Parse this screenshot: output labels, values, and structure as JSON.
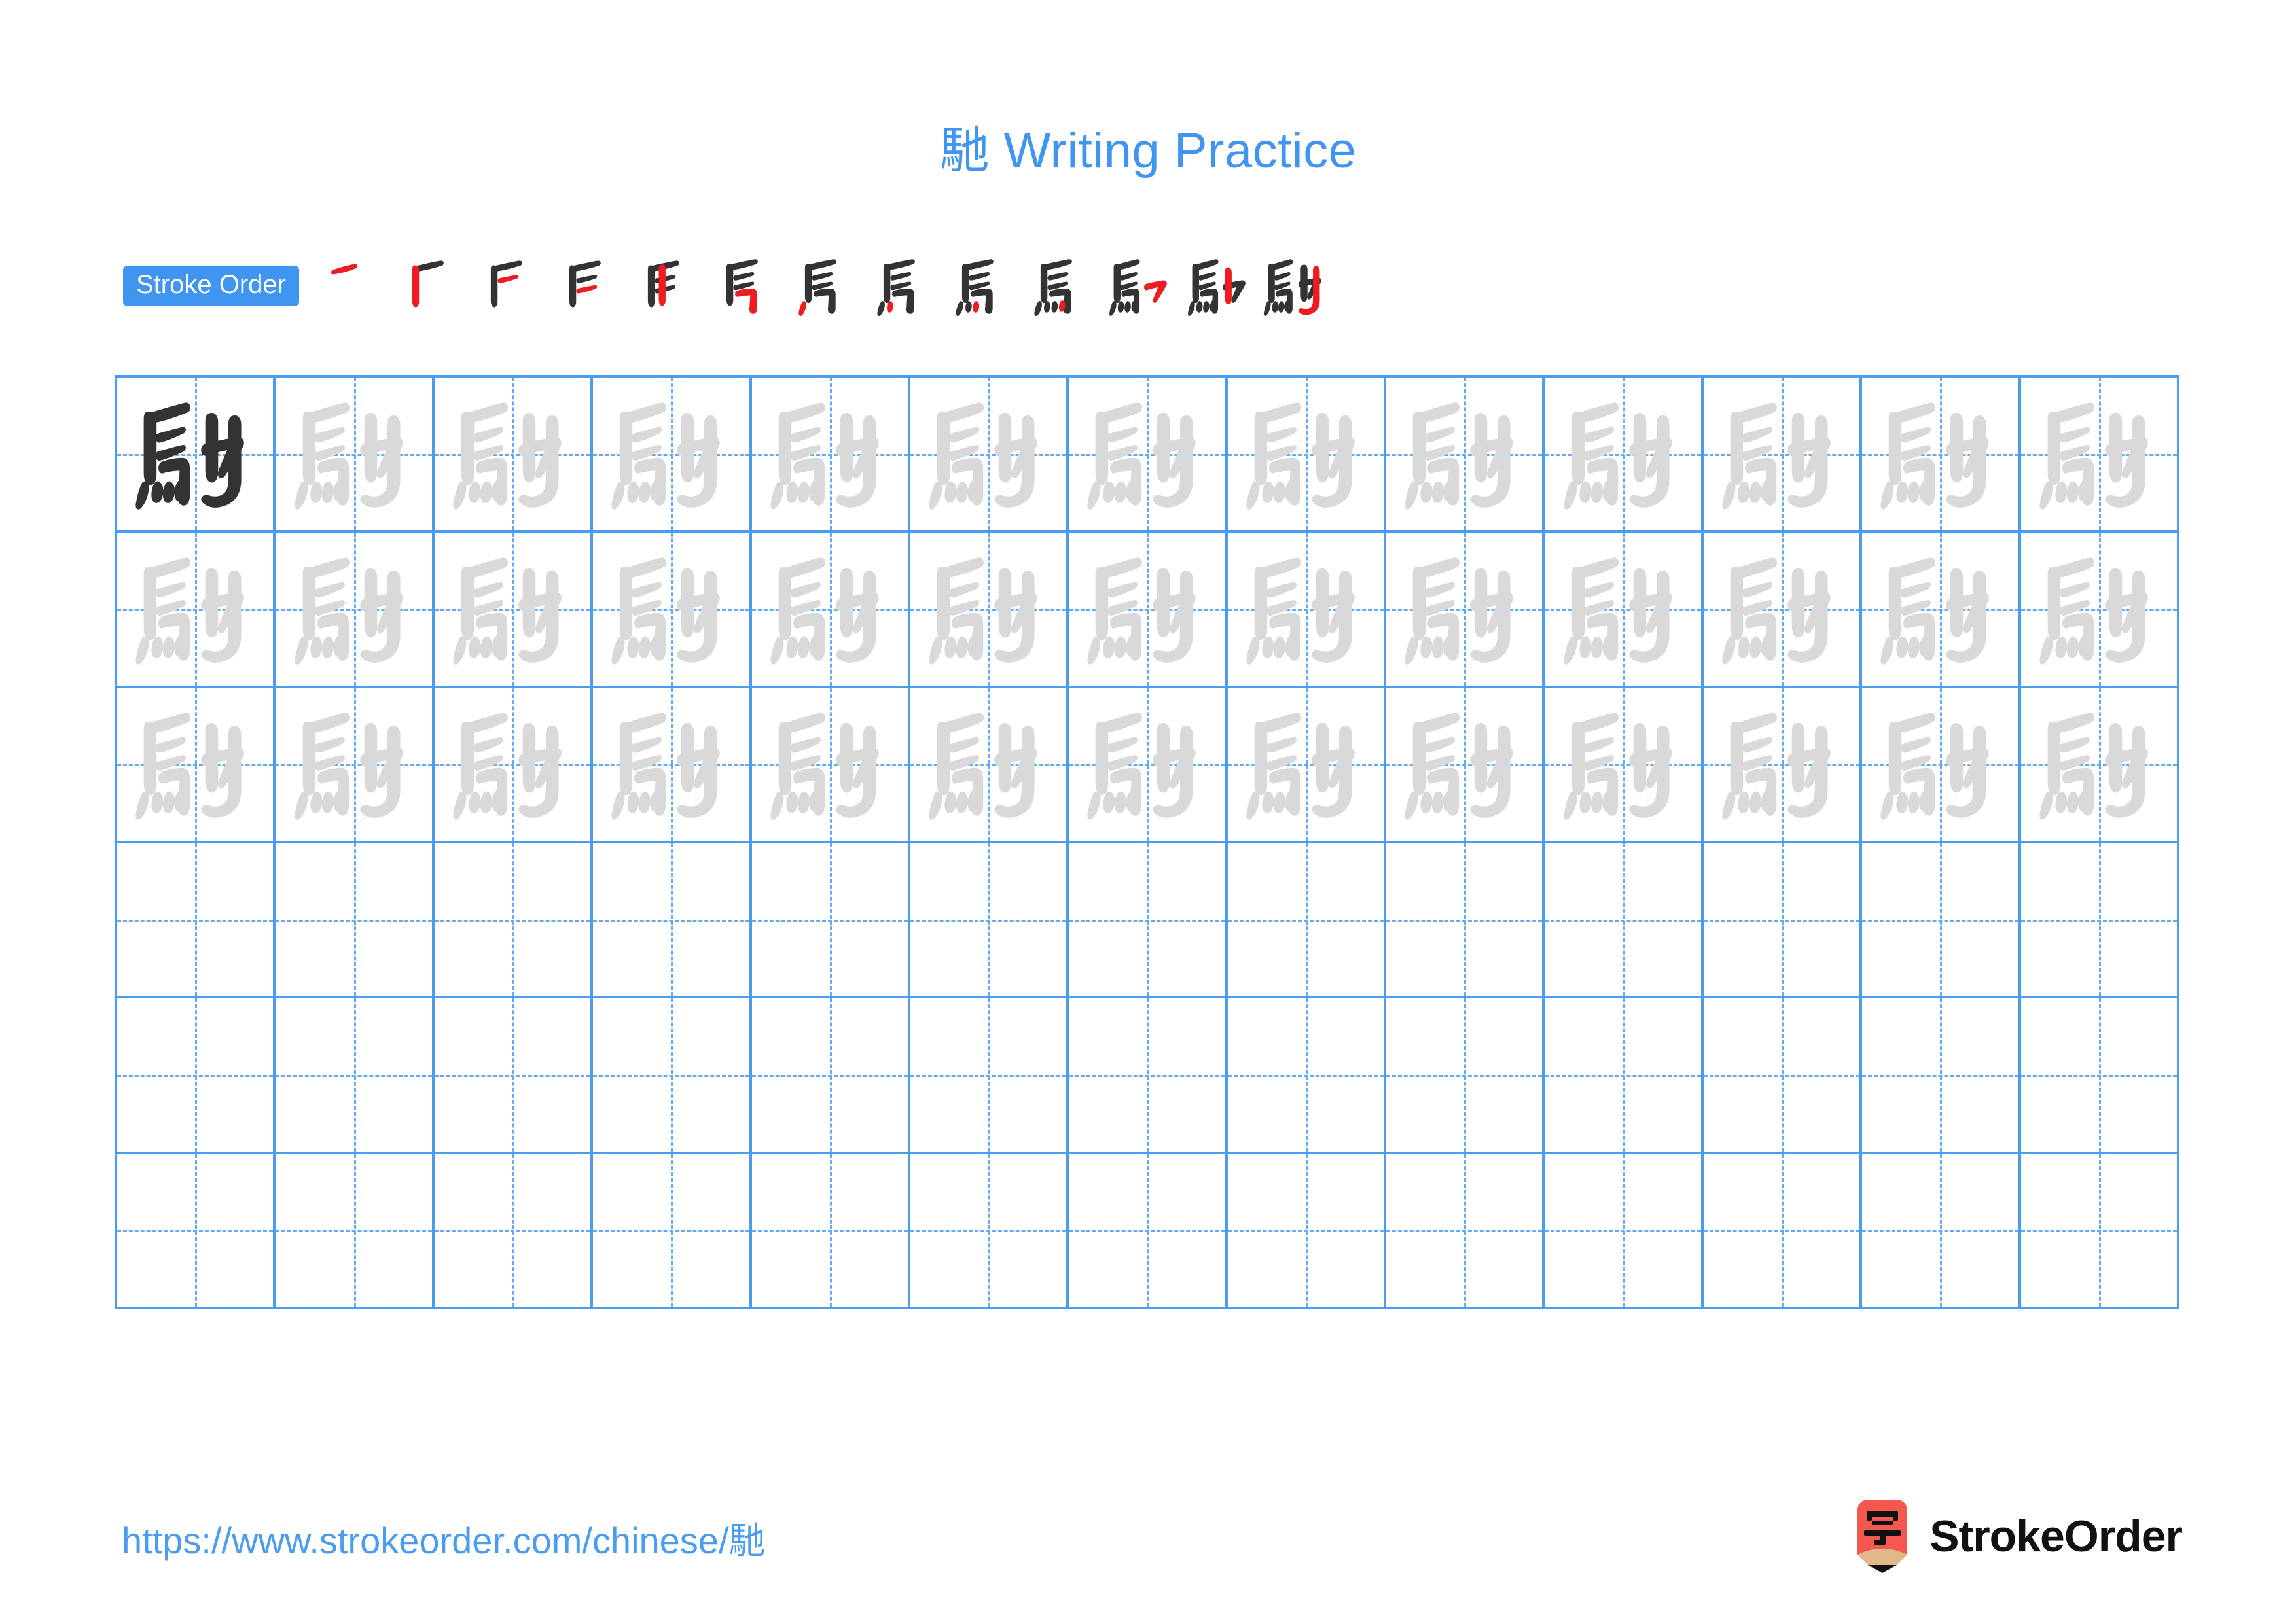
{
  "character": "馳",
  "title": "馳 Writing Practice",
  "stroke_order": {
    "badge_label": "Stroke Order",
    "total_strokes": 13,
    "steps": [
      {
        "index": 1,
        "new_stroke": "heng",
        "glyph": "一"
      },
      {
        "index": 2,
        "new_stroke": "shu",
        "glyph": "厂"
      },
      {
        "index": 3,
        "new_stroke": "heng",
        "glyph": "F"
      },
      {
        "index": 4,
        "new_stroke": "heng",
        "glyph": "F"
      },
      {
        "index": 5,
        "new_stroke": "shu",
        "glyph": "馬"
      },
      {
        "index": 6,
        "new_stroke": "heng-zhe-gou",
        "glyph": "馬"
      },
      {
        "index": 7,
        "new_stroke": "dian",
        "glyph": "馬"
      },
      {
        "index": 8,
        "new_stroke": "dian",
        "glyph": "馬"
      },
      {
        "index": 9,
        "new_stroke": "dian",
        "glyph": "馬"
      },
      {
        "index": 10,
        "new_stroke": "dian",
        "glyph": "馬"
      },
      {
        "index": 11,
        "new_stroke": "heng-zhe-gou",
        "glyph": "馳"
      },
      {
        "index": 12,
        "new_stroke": "shu",
        "glyph": "馳"
      },
      {
        "index": 13,
        "new_stroke": "shu-wan-gou",
        "glyph": "馳"
      }
    ]
  },
  "grid": {
    "columns": 13,
    "rows": 6,
    "filled_rows": 3,
    "empty_rows": 3,
    "model_cell": {
      "row": 1,
      "column": 1,
      "ink": "dark"
    },
    "trace_ink": "light"
  },
  "footer": {
    "url": "https://www.strokeorder.com/chinese/馳",
    "brand_name": "StrokeOrder",
    "brand_mark_glyph": "字"
  },
  "colors": {
    "accent_blue": "#3f95ef",
    "grid_blue": "#4a9cf0",
    "grid_dash_blue": "#63aaf4",
    "stroke_new_red": "#ec1c21",
    "stroke_done_dark": "#333333",
    "trace_gray": "#d9d9d9",
    "logo_red": "#f4584f",
    "logo_wood": "#e0b88a"
  }
}
